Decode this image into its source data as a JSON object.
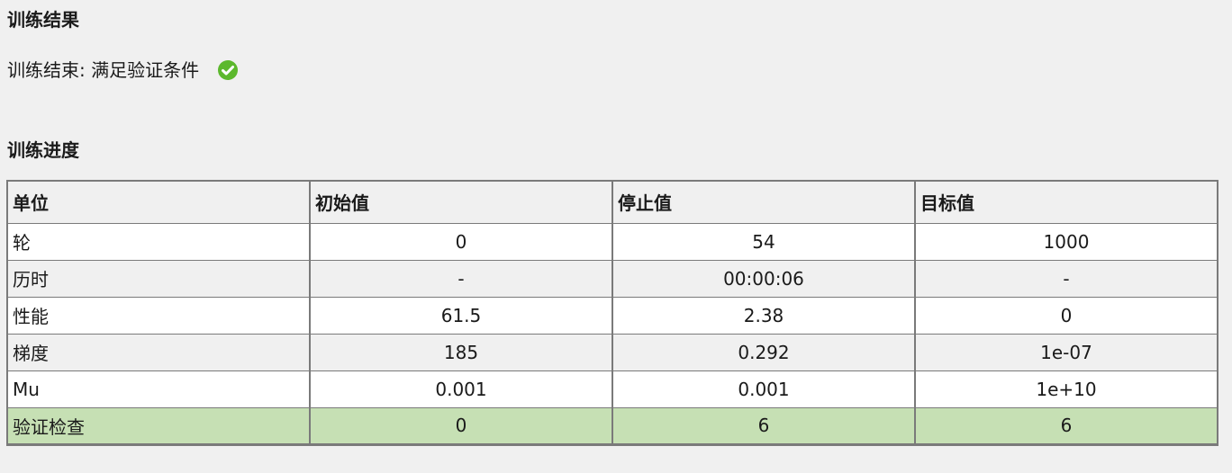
{
  "results": {
    "title": "训练结果",
    "status_text": "训练结束: 满足验证条件",
    "status_icon": "check-circle-icon",
    "status_color": "#5cb82d"
  },
  "progress": {
    "title": "训练进度",
    "headers": [
      "单位",
      "初始值",
      "停止值",
      "目标值"
    ],
    "rows": [
      {
        "label": "轮",
        "initial": "0",
        "stopped": "54",
        "target": "1000"
      },
      {
        "label": "历时",
        "initial": "-",
        "stopped": "00:00:06",
        "target": "-"
      },
      {
        "label": "性能",
        "initial": "61.5",
        "stopped": "2.38",
        "target": "0"
      },
      {
        "label": "梯度",
        "initial": "185",
        "stopped": "0.292",
        "target": "1e-07"
      },
      {
        "label": "Mu",
        "initial": "0.001",
        "stopped": "0.001",
        "target": "1e+10"
      },
      {
        "label": "验证检查",
        "initial": "0",
        "stopped": "6",
        "target": "6"
      }
    ],
    "highlight_color": "#c6e0b4"
  }
}
